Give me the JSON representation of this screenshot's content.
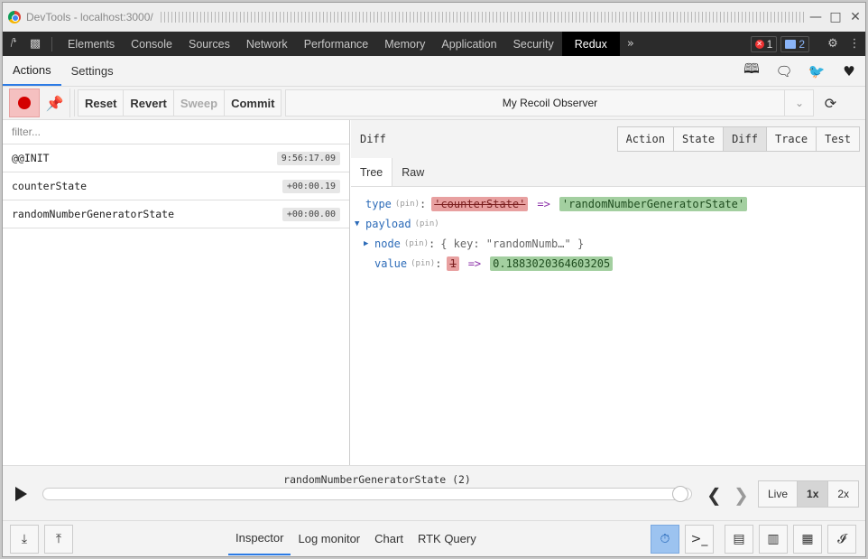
{
  "titlebar": {
    "title": "DevTools - localhost:3000/"
  },
  "devtools_tabs": [
    "Elements",
    "Console",
    "Sources",
    "Network",
    "Performance",
    "Memory",
    "Application",
    "Security",
    "Redux"
  ],
  "badges": {
    "errors": "1",
    "messages": "2"
  },
  "subtabs": [
    "Actions",
    "Settings"
  ],
  "toolbar": {
    "reset": "Reset",
    "revert": "Revert",
    "sweep": "Sweep",
    "commit": "Commit",
    "instance": "My Recoil Observer"
  },
  "filter": {
    "placeholder": "filter..."
  },
  "actions": [
    {
      "name": "@@INIT",
      "time": "9:56:17.09"
    },
    {
      "name": "counterState",
      "time": "+00:00.19"
    },
    {
      "name": "randomNumberGeneratorState",
      "time": "+00:00.00"
    }
  ],
  "inspector": {
    "label": "Diff",
    "modes": [
      "Action",
      "State",
      "Diff",
      "Trace",
      "Test"
    ],
    "views": [
      "Tree",
      "Raw"
    ],
    "tree": {
      "type_key": "type",
      "pin": "(pin)",
      "type_old": "'counterState'",
      "type_new": "'randomNumberGeneratorState'",
      "arrow": "=>",
      "payload_key": "payload",
      "node_key": "node",
      "node_preview": "{ key: \"randomNumb…\" }",
      "value_key": "value",
      "value_old": "1",
      "value_new": "0.1883020364603205"
    }
  },
  "slider": {
    "label": "randomNumberGeneratorState (2)",
    "position_fraction": 1.0,
    "speeds": [
      "Live",
      "1x",
      "2x"
    ]
  },
  "footer": {
    "tabs": [
      "Inspector",
      "Log monitor",
      "Chart",
      "RTK Query"
    ]
  },
  "colors": {
    "accent": "#2c7be5",
    "record": "#d40000",
    "removed": "#e8a0a0",
    "added": "#a3cfa0"
  }
}
